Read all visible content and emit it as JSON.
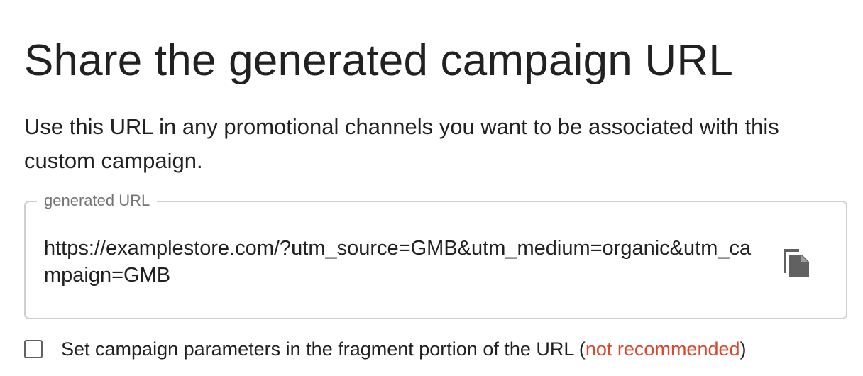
{
  "heading": "Share the generated campaign URL",
  "description": "Use this URL in any promotional channels you want to be associated with this custom campaign.",
  "url_field": {
    "legend": "generated URL",
    "value": "https://examplestore.com/?utm_source=GMB&utm_medium=organic&utm_campaign=GMB",
    "copy_icon": "copy-icon"
  },
  "fragment_option": {
    "checked": false,
    "label": "Set campaign parameters in the fragment portion of the URL",
    "paren_open": " (",
    "warning": "not recommended",
    "paren_close": ")",
    "warning_color": "#d9482f"
  }
}
